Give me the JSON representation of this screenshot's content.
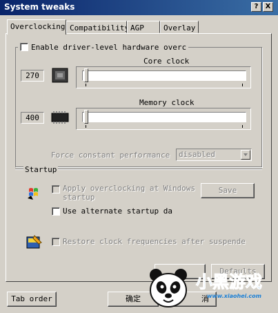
{
  "window": {
    "title": "System tweaks",
    "help_label": "?",
    "close_label": "X"
  },
  "tabs": [
    {
      "label": "Overclocking"
    },
    {
      "label": "Compatibility"
    },
    {
      "label": "AGP"
    },
    {
      "label": "Overlay"
    }
  ],
  "overclocking": {
    "enable_label": "Enable driver-level hardware overc",
    "core": {
      "title": "Core clock",
      "value": "270",
      "icon": "gpu-chip-icon",
      "level": 0
    },
    "memory": {
      "title": "Memory clock",
      "value": "400",
      "icon": "memory-chip-icon",
      "level": 0
    },
    "force_label": "Force constant performance",
    "force_value": "disabled"
  },
  "startup": {
    "title": "Startup",
    "apply_label": "Apply overclocking at Windows",
    "apply_label_2": "startup",
    "save_label": "Save",
    "alternate_label": "Use alternate startup da",
    "restore_label": "Restore clock frequencies after suspende"
  },
  "buttons": {
    "defaults_label": "Defaults",
    "tab_order_label": "Tab order",
    "ok_label": "确定",
    "cancel_label": "消"
  },
  "watermark": {
    "brand": "小黑游戏",
    "url": "www.xiaohei.com"
  },
  "colors": {
    "titlebar_start": "#0a246a",
    "titlebar_end": "#3a6ea5",
    "face": "#d4d0c8",
    "watermark_blue": "#1a7fd6"
  }
}
